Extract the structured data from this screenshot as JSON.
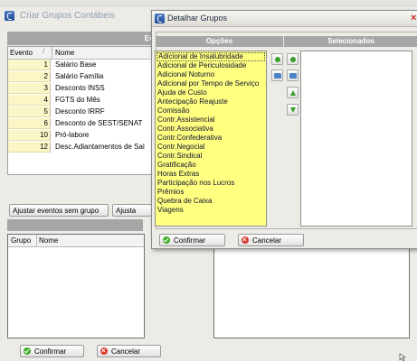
{
  "back_window": {
    "title": "Criar Grupos Contábeis",
    "section_header": "Eve",
    "events_table": {
      "columns": [
        "Evento",
        "Nome"
      ],
      "rows": [
        {
          "num": "1",
          "name": "Salário Base"
        },
        {
          "num": "2",
          "name": "Salário Família"
        },
        {
          "num": "3",
          "name": "Desconto INSS"
        },
        {
          "num": "4",
          "name": "FGTS do Mês"
        },
        {
          "num": "5",
          "name": "Desconto IRRF"
        },
        {
          "num": "6",
          "name": "Desconto de SEST/SENAT"
        },
        {
          "num": "10",
          "name": "Pró-labore"
        },
        {
          "num": "12",
          "name": "Desc.Adiantamentos de Sal"
        }
      ]
    },
    "adjust_events_button": "Ajustar eventos sem grupo",
    "adjust_button_partial": "Ajusta",
    "groups_table": {
      "columns": [
        "Grupo",
        "Nome"
      ]
    },
    "confirm_button": "Confirmar",
    "cancel_button": "Cancelar"
  },
  "dialog": {
    "title": "Detalhar Grupos",
    "options_header": "Opções",
    "selected_header": "Selecionados",
    "options": [
      "Adicional de Insalubridade",
      "Adicional de Periculosidade",
      "Adicional Noturno",
      "Adicional por Tempo de Serviço",
      "Ajuda de Custo",
      "Antecipação Reajuste",
      "Comissão",
      "Contr.Assistencial",
      "Contr.Associativa",
      "Contr.Confederativa",
      "Contr.Negocial",
      "Contr.Sindical",
      "Gratificação",
      "Horas Extras",
      "Participação nos Lucros",
      "Prêmios",
      "Quebra de Caixa",
      "Viagens"
    ],
    "selected_option_index": 0,
    "selected": [],
    "confirm_button": "Confirmar",
    "cancel_button": "Cancelar"
  },
  "colors": {
    "options_list_bg": "#ffff80",
    "event_num_bg": "#fbf6c6",
    "header_grey": "#a7a7a7"
  }
}
